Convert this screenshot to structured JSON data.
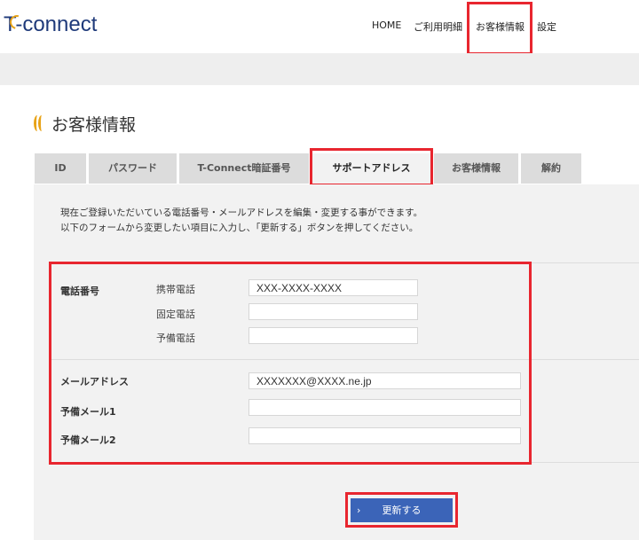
{
  "header": {
    "logo_text": "T-connect",
    "nav": [
      "HOME",
      "ご利用明細",
      "お客様情報",
      "設定"
    ]
  },
  "page": {
    "title": "お客様情報"
  },
  "tabs": [
    "ID",
    "パスワード",
    "T-Connect暗証番号",
    "サポートアドレス",
    "お客様情報",
    "解約"
  ],
  "active_tab": "サポートアドレス",
  "intro": {
    "line1": "現在ご登録いただいている電話番号・メールアドレスを編集・変更する事ができます。",
    "line2": "以下のフォームから変更したい項目に入力し、「更新する」ボタンを押してください。"
  },
  "form": {
    "phone_section_label": "電話番号",
    "mobile_label": "携帯電話",
    "mobile_value": "XXX-XXXX-XXXX",
    "landline_label": "固定電話",
    "landline_value": "",
    "spare_phone_label": "予備電話",
    "spare_phone_value": "",
    "email_label": "メールアドレス",
    "email_value": "XXXXXXX@XXXX.ne.jp",
    "spare_mail1_label": "予備メール1",
    "spare_mail1_value": "",
    "spare_mail2_label": "予備メール2",
    "spare_mail2_value": ""
  },
  "submit": {
    "chevron": "›",
    "label": "更新する"
  },
  "colors": {
    "highlight": "#e8262f",
    "brand_blue": "#1f3a7a",
    "button_blue": "#3b64b8",
    "accent_orange": "#e8a317"
  }
}
